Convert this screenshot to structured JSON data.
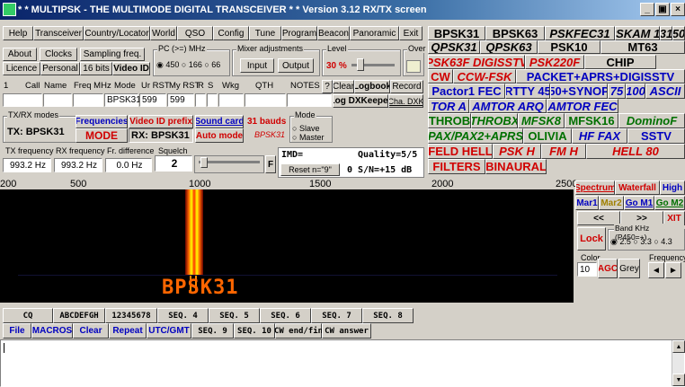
{
  "title": "* * MULTIPSK - THE MULTIMODE DIGITAL TRANSCEIVER * *  Version 3.12      RX/TX screen",
  "window_controls": [
    "_",
    "▣",
    "×"
  ],
  "menu_row1": [
    "Help",
    "Transceiver",
    "Country/Locator",
    "World",
    "QSO",
    "Config",
    "Tune",
    "Program",
    "Beacon",
    "Panoramic",
    "Exit"
  ],
  "menu_row2": {
    "about": "About",
    "clocks": "Clocks",
    "sampling": "Sampling freq.",
    "licence": "Licence",
    "personal": "Personal",
    "bits": "16 bits",
    "videoid": "Video ID"
  },
  "pc_group": {
    "legend": "PC (>=) MHz",
    "opts": [
      "450",
      "166",
      "66"
    ]
  },
  "mixer": {
    "legend": "Mixer adjustments",
    "input": "Input",
    "output": "Output"
  },
  "level": {
    "legend": "Level",
    "value": "30 %"
  },
  "over": "Over",
  "qso_headers": [
    "1",
    "Call",
    "Name",
    "Freq MHz",
    "Mode",
    "Ur RST",
    "My RST",
    "R",
    "S",
    "Wkg",
    "QTH",
    "NOTES"
  ],
  "qso_values": {
    "mode": "BPSK31",
    "urrst": "599",
    "myrst": "599"
  },
  "qso_buttons": {
    "q": "?",
    "clear": "Clear",
    "logbook": "Logbook",
    "record": "Record",
    "dxkeeper": "Log DXKeeper",
    "chadxk": "Cha. DXK"
  },
  "txrx": {
    "legend": "TX/RX modes",
    "frequencies": "Frequencies",
    "tx": "TX: BPSK31",
    "mode_btn": "MODE",
    "videoprefix": "Video ID prefix",
    "rx": "RX: BPSK31",
    "soundcard": "Sound card",
    "automode": "Auto mode",
    "bauds": "31 bauds",
    "bpsk": "BPSK31",
    "modegroup": "Mode",
    "slave": "Slave",
    "master": "Master"
  },
  "freq": {
    "txlbl": "TX frequency",
    "rxlbl": "RX frequency",
    "fdlbl": "Fr. difference",
    "sqlbl": "Squelch",
    "tx": "993.2 Hz",
    "rx": "993.2 Hz",
    "fd": "0.0 Hz",
    "sq": "2",
    "f": "F"
  },
  "imd": {
    "imd": "IMD=",
    "quality": "Quality=5/5",
    "reset": "Reset n=\"9\"",
    "zero": "0",
    "sn": "S/N=+15 dB"
  },
  "modes": [
    [
      "BPSK31",
      "BPSK63",
      "PSKFEC31",
      "PSKAM 10",
      "31",
      "50"
    ],
    [
      "QPSK31",
      "QPSK63",
      "PSK10",
      "MT63"
    ],
    [
      "PSK63F DIGISSTV",
      "PSK220F",
      "CHIP"
    ],
    [
      "CW",
      "CCW-FSK",
      "PACKET+APRS+DIGISSTV"
    ],
    [
      "Pactor1 FEC",
      "RTTY 45",
      "50+SYNOP",
      "75",
      "100",
      "ASCII"
    ],
    [
      "TOR A",
      "AMTOR ARQ",
      "AMTOR FEC"
    ],
    [
      "THROB",
      "THROBX",
      "MFSK8",
      "MFSK16",
      "DominoF"
    ],
    [
      "PAX/PAX2+APRS",
      "OLIVIA",
      "HF FAX",
      "SSTV"
    ],
    [
      "FELD HELL",
      "PSK H",
      "FM H",
      "HELL 80"
    ],
    [
      "FILTERS",
      "BINAURAL"
    ]
  ],
  "scale": [
    "200",
    "500",
    "1000",
    "1500",
    "2000",
    "2500"
  ],
  "waterfall_text": "BPSK31",
  "right_panel": {
    "spectrum": "Spectrum",
    "waterfall": "Waterfall",
    "high": "High",
    "mar1": "Mar1",
    "mar2": "Mar2",
    "gom1": "Go M1",
    "gom2": "Go M2",
    "left": "<<",
    "right": ">>",
    "xit": "XIT",
    "lock": "Lock",
    "band": "Band KHz (P450=+)",
    "b1": "2.5",
    "b2": "3.3",
    "b3": "4.3",
    "color": "Color",
    "colorv": "10",
    "agc": "AGC",
    "grey": "Grey",
    "freqlbl": "Frequency",
    "fl": "◄",
    "fr": "►"
  },
  "macros_row1": [
    "CQ",
    "ABCDEFGH",
    "12345678",
    "SEQ. 4",
    "SEQ. 5",
    "SEQ. 6",
    "SEQ. 7",
    "SEQ. 8"
  ],
  "macros_row2": [
    "File",
    "MACROS",
    "Clear",
    "Repeat",
    "UTC/GMT",
    "SEQ. 9",
    "SEQ. 10",
    "CW end/fin",
    "CW answer"
  ],
  "colors": {
    "title_start": "#0a246a",
    "mode_red": "#d00000",
    "mode_blue": "#0000c0",
    "mode_green": "#007000"
  }
}
